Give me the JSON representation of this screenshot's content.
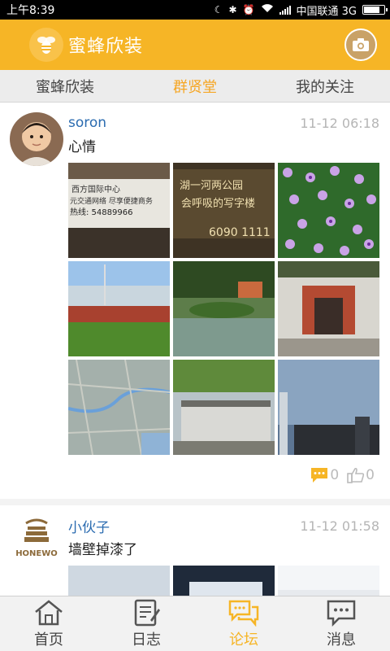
{
  "status_bar": {
    "time": "上午8:39",
    "carrier": "中国联通 3G",
    "battery_level": 0.8,
    "icons": [
      "moon-icon",
      "bluetooth-icon",
      "alarm-icon",
      "wifi-icon",
      "signal-icon",
      "battery-icon"
    ]
  },
  "header": {
    "title": "蜜蜂欣装",
    "logo_icon": "bee-logo-icon",
    "camera_icon": "camera-icon",
    "bg_color": "#f6b526"
  },
  "tabs": [
    {
      "label": "蜜蜂欣装",
      "active": false
    },
    {
      "label": "群贤堂",
      "active": true
    },
    {
      "label": "我的关注",
      "active": false
    }
  ],
  "posts": [
    {
      "author": "soron",
      "time": "11-12 06:18",
      "content": "心情",
      "avatar": "child-photo-avatar",
      "images": [
        {
          "caption_lines": [
            "西方国际中心",
            "元交通网络 尽享便捷商务",
            "热线: 54889966"
          ]
        },
        {
          "caption_lines": [
            "湖一河两公园",
            "会呼吸的写字楼",
            "6090 1111"
          ]
        },
        {
          "caption_lines": []
        },
        {
          "caption_lines": []
        },
        {
          "caption_lines": []
        },
        {
          "caption_lines": []
        },
        {
          "caption_lines": []
        },
        {
          "caption_lines": []
        },
        {
          "caption_lines": []
        }
      ],
      "comments": "0",
      "likes": "0"
    },
    {
      "author": "小伙子",
      "time": "11-12 01:58",
      "content": "墙壁掉漆了",
      "avatar": "honewo-logo-avatar",
      "avatar_text": "HONEWO",
      "images": [
        {},
        {},
        {}
      ]
    }
  ],
  "bottom_nav": [
    {
      "label": "首页",
      "icon": "home-icon",
      "active": false
    },
    {
      "label": "日志",
      "icon": "journal-icon",
      "active": false
    },
    {
      "label": "论坛",
      "icon": "forum-icon",
      "active": true
    },
    {
      "label": "消息",
      "icon": "message-icon",
      "active": false
    }
  ]
}
